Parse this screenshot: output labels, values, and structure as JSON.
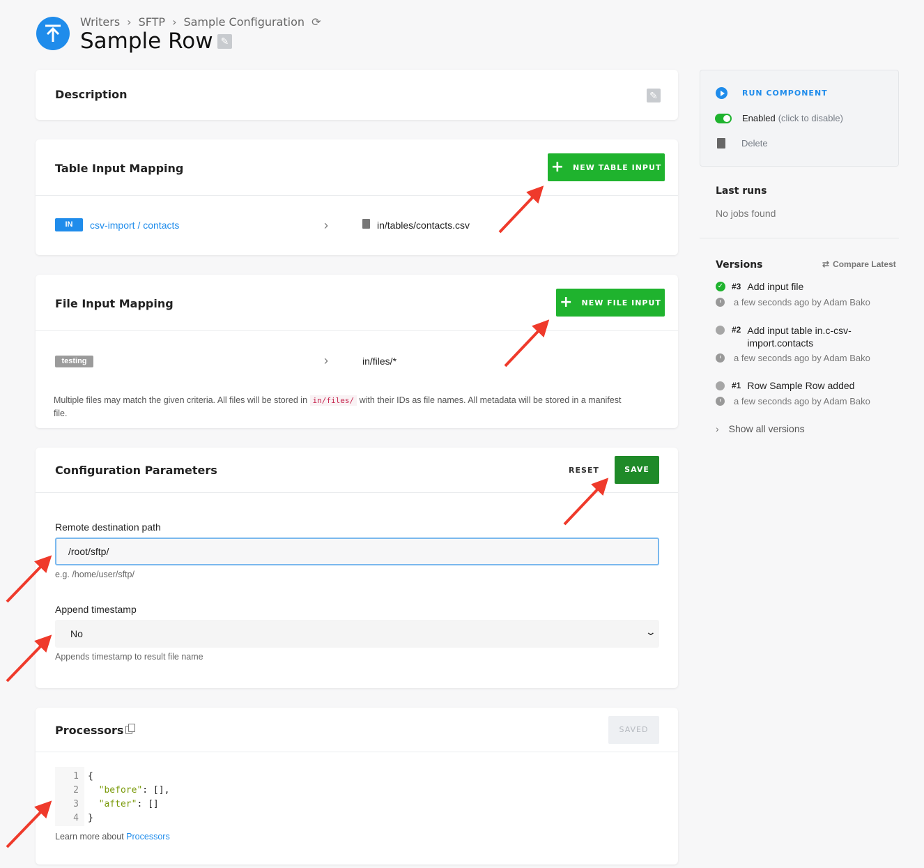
{
  "header": {
    "breadcrumbs": [
      "Writers",
      "SFTP",
      "Sample Configuration"
    ],
    "title": "Sample Row"
  },
  "description": {
    "title": "Description"
  },
  "table_input": {
    "title": "Table Input Mapping",
    "button": "NEW TABLE INPUT",
    "row": {
      "badge": "IN",
      "source": "csv-import / contacts",
      "destination": "in/tables/contacts.csv"
    }
  },
  "file_input": {
    "title": "File Input Mapping",
    "button": "NEW FILE INPUT",
    "row": {
      "tag": "testing",
      "destination": "in/files/*"
    },
    "note_before": "Multiple files may match the given criteria. All files will be stored in",
    "note_code": "in/files/",
    "note_after": "with their IDs as file names. All metadata will be stored in a manifest",
    "note_end": "file."
  },
  "config": {
    "title": "Configuration Parameters",
    "reset": "RESET",
    "save": "SAVE",
    "remote_label": "Remote destination path",
    "remote_value": "/root/sftp/",
    "remote_help": "e.g. /home/user/sftp/",
    "timestamp_label": "Append timestamp",
    "timestamp_value": "No",
    "timestamp_help": "Appends timestamp to result file name"
  },
  "processors": {
    "title": "Processors",
    "saved": "SAVED",
    "code": [
      {
        "n": "1",
        "text": "{"
      },
      {
        "n": "2",
        "key": "\"before\"",
        "rest": ": [],"
      },
      {
        "n": "3",
        "key": "\"after\"",
        "rest": ": []"
      },
      {
        "n": "4",
        "text": "}"
      }
    ],
    "learn_prefix": "Learn more about",
    "learn_link": "Processors"
  },
  "sidebar": {
    "run": "RUN COMPONENT",
    "enabled": "Enabled",
    "enabled_hint": "(click to disable)",
    "delete": "Delete",
    "last_runs_title": "Last runs",
    "last_runs_empty": "No jobs found",
    "versions_title": "Versions",
    "compare": "Compare Latest",
    "versions": [
      {
        "num": "#3",
        "text": "Add input file",
        "meta": "a few seconds ago by Adam Bako"
      },
      {
        "num": "#2",
        "text": "Add input table in.c-csv-",
        "text2": "import.contacts",
        "meta": "a few seconds ago by Adam Bako"
      },
      {
        "num": "#1",
        "text": "Row Sample Row added",
        "meta": "a few seconds ago by Adam Bako"
      }
    ],
    "show_all": "Show all versions"
  },
  "colors": {
    "accent": "#1f8ceb",
    "green": "#1fb32e",
    "dark_green": "#1f8a28",
    "arrow": "#ef3a2b"
  }
}
